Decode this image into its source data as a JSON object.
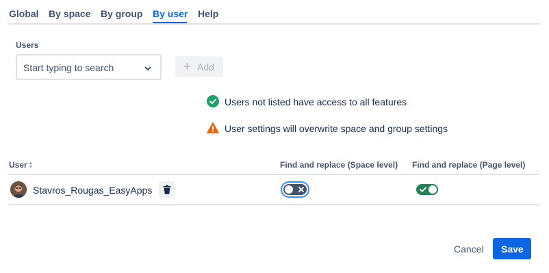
{
  "tabs": [
    {
      "label": "Global",
      "active": false
    },
    {
      "label": "By space",
      "active": false
    },
    {
      "label": "By group",
      "active": false
    },
    {
      "label": "By user",
      "active": true
    },
    {
      "label": "Help",
      "active": false
    }
  ],
  "users_field": {
    "label": "Users",
    "placeholder": "Start typing to search",
    "chevron_icon": "chevron-down-icon"
  },
  "add_button": {
    "label": "Add",
    "icon": "plus-icon",
    "disabled": true
  },
  "messages": [
    {
      "icon": "check-circle-icon",
      "color": "#22a06b",
      "text": "Users not listed have access to all features"
    },
    {
      "icon": "warning-icon",
      "color": "#e56910",
      "text": "User settings will overwrite space and group settings"
    }
  ],
  "table": {
    "columns": [
      "User",
      "Find and replace (Space level)",
      "Find and replace (Page level)"
    ],
    "sort_icon": "sort-icon",
    "rows": [
      {
        "user": "Stavros_Rougas_EasyApps",
        "avatar_icon": "user-avatar",
        "delete_icon": "trash-icon",
        "space_level_enabled": false,
        "page_level_enabled": true
      }
    ]
  },
  "footer": {
    "cancel_label": "Cancel",
    "save_label": "Save"
  },
  "colors": {
    "accent": "#0c66e4",
    "success": "#1f845a",
    "warning": "#e56910",
    "toggle_off": "#44546f",
    "focus_ring": "#388bff"
  }
}
